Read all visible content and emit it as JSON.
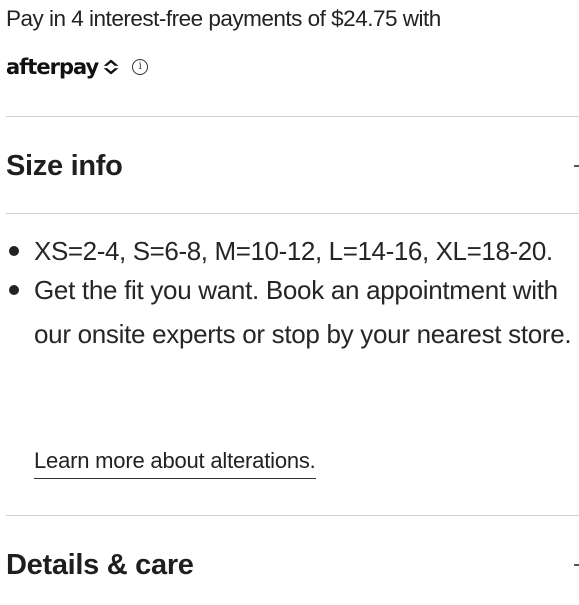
{
  "payment": {
    "text": "Pay in 4 interest-free payments of $24.75 with",
    "provider_logo": "afterpay",
    "info_icon_glyph": "i"
  },
  "sections": [
    {
      "title": "Size info",
      "toggle_icon": "minus-icon",
      "items": [
        "XS=2-4, S=6-8, M=10-12, L=14-16, XL=18-20.",
        "Get the fit you want. Book an appointment with our onsite experts or stop by your nearest store."
      ],
      "link": "Learn more about alterations."
    },
    {
      "title": "Details & care",
      "toggle_icon": "minus-icon"
    }
  ],
  "colors": {
    "text": "#222222",
    "divider": "#cfcfcf",
    "background": "#ffffff"
  }
}
